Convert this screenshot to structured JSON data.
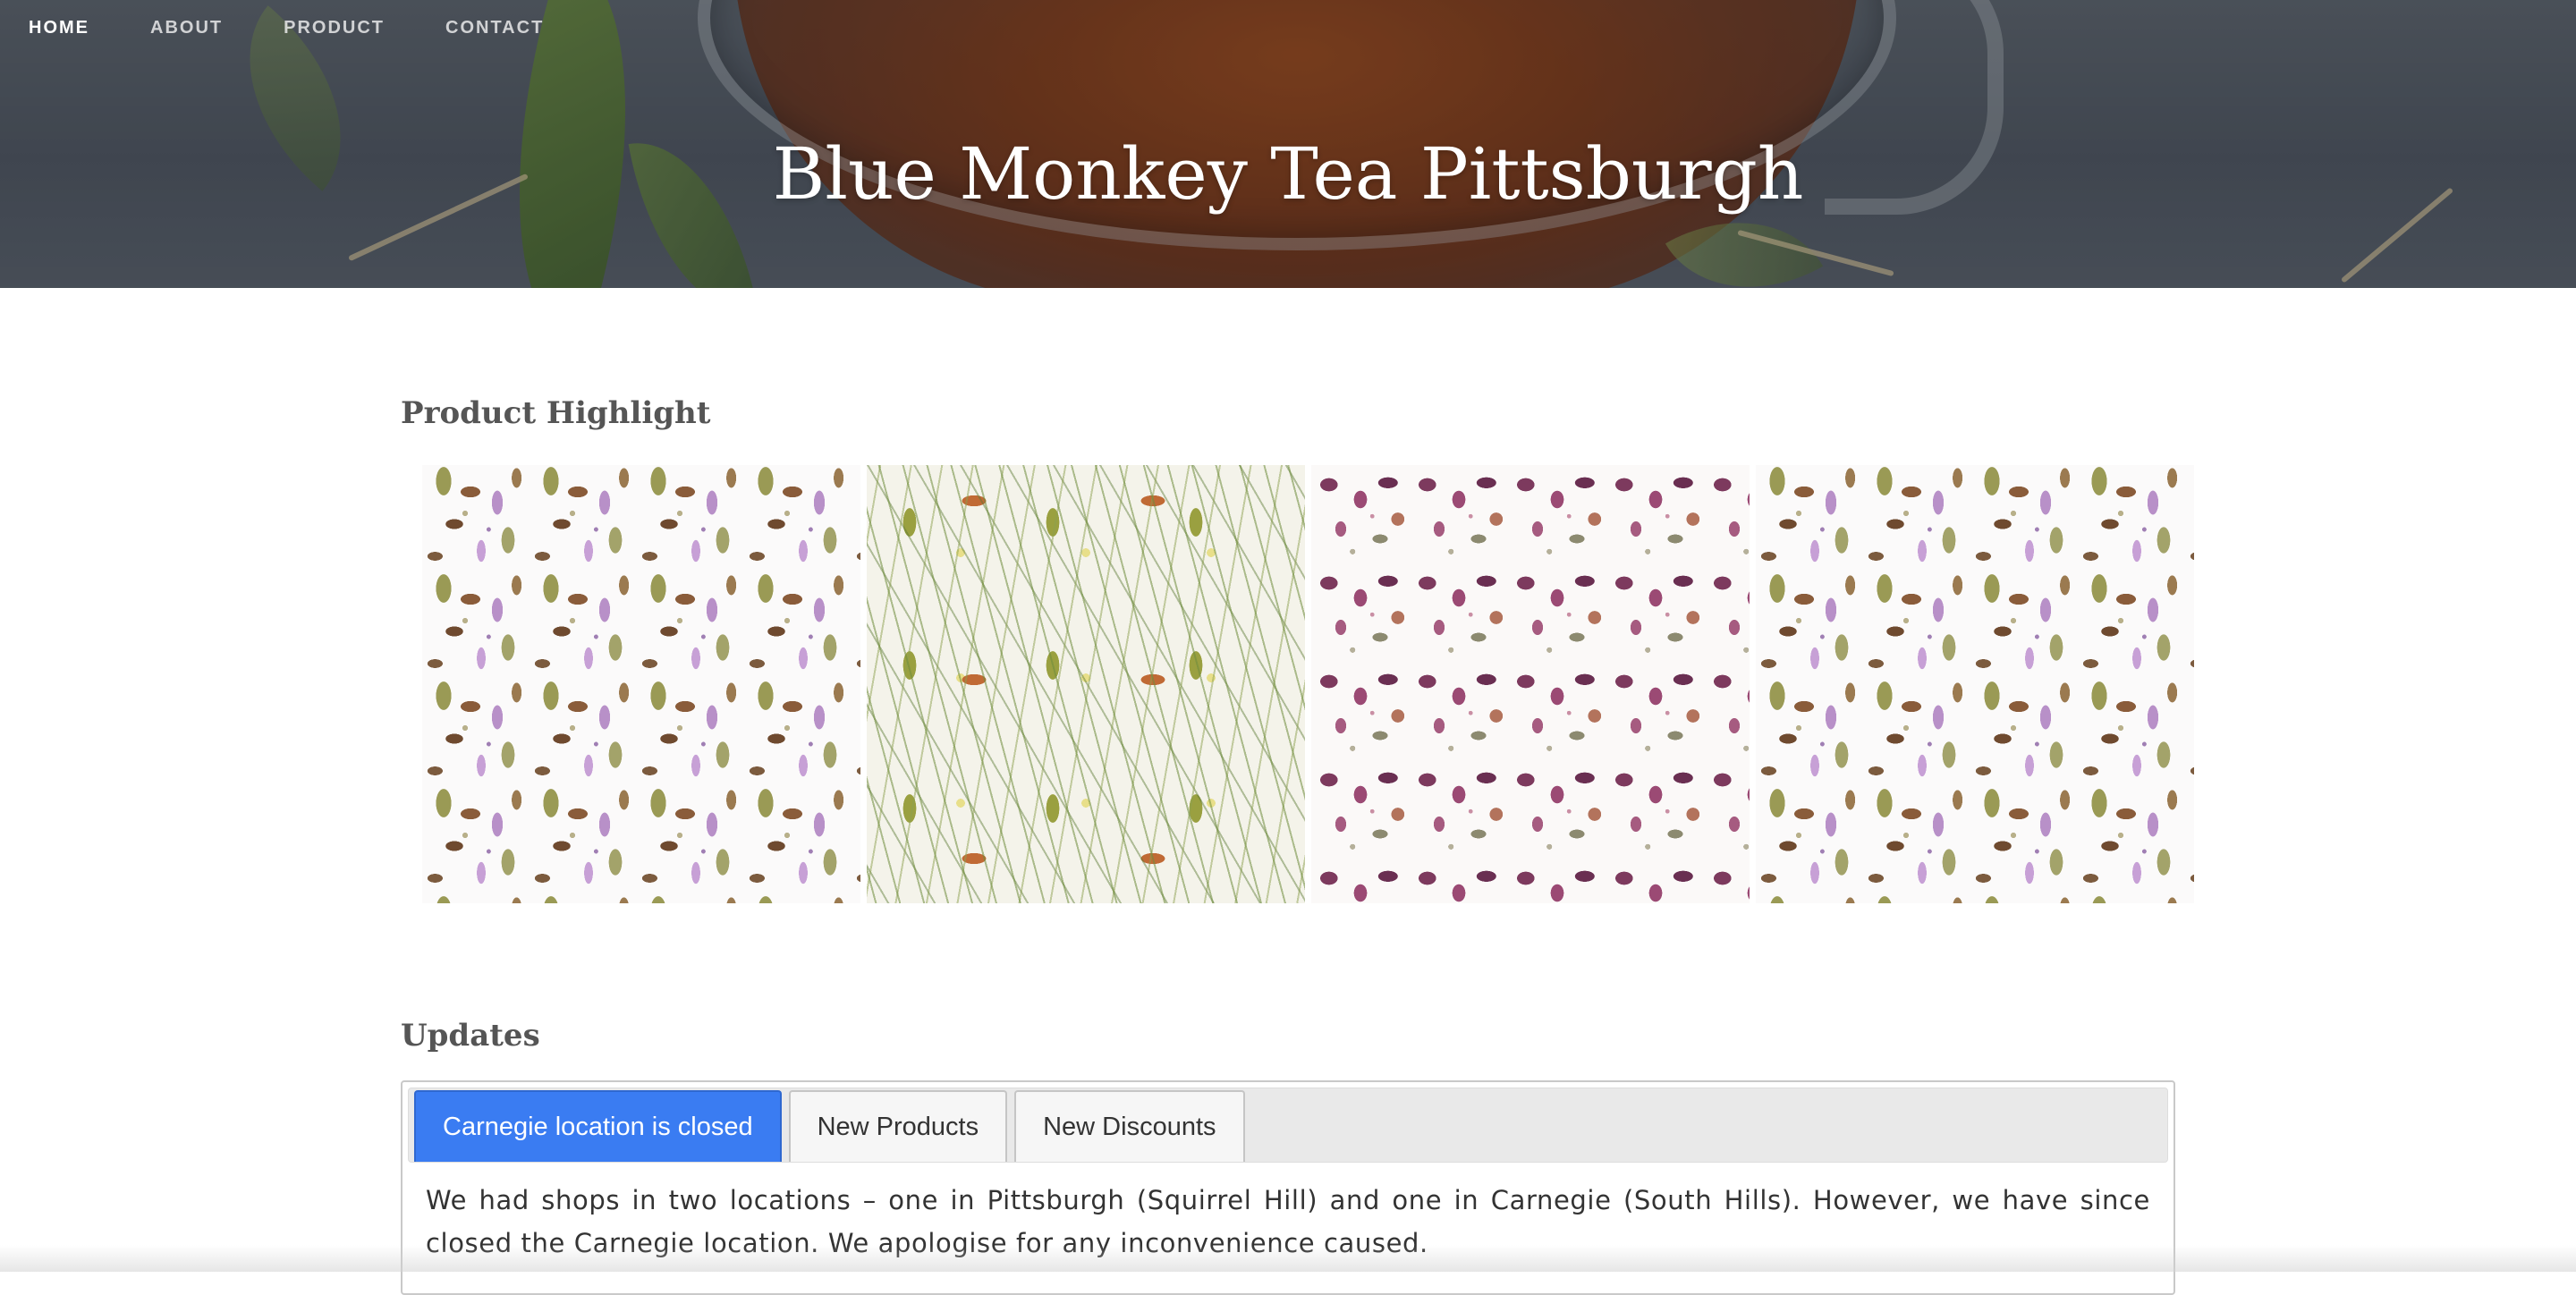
{
  "nav": {
    "items": [
      {
        "label": "HOME",
        "active": true
      },
      {
        "label": "ABOUT",
        "active": false
      },
      {
        "label": "PRODUCT",
        "active": false
      },
      {
        "label": "CONTACT",
        "active": false
      }
    ]
  },
  "hero": {
    "title": "Blue Monkey Tea Pittsburgh"
  },
  "products": {
    "heading": "Product Highlight",
    "images": [
      {
        "icon": "herbal-tea-blend-image"
      },
      {
        "icon": "green-grass-tea-blend-image"
      },
      {
        "icon": "rose-petal-tea-blend-image"
      },
      {
        "icon": "herbal-tea-blend-image"
      }
    ]
  },
  "updates": {
    "heading": "Updates",
    "tabs": [
      {
        "label": "Carnegie location is closed",
        "active": true
      },
      {
        "label": "New Products",
        "active": false
      },
      {
        "label": "New Discounts",
        "active": false
      }
    ],
    "panel_text": "We had shops in two locations – one in Pittsburgh (Squirrel Hill) and one in Carnegie (South Hills). However, we have since closed the Carnegie location. We apologise for any inconvenience caused."
  },
  "colors": {
    "accent": "#3a7cf2",
    "heading": "#555555",
    "text": "#333333"
  }
}
